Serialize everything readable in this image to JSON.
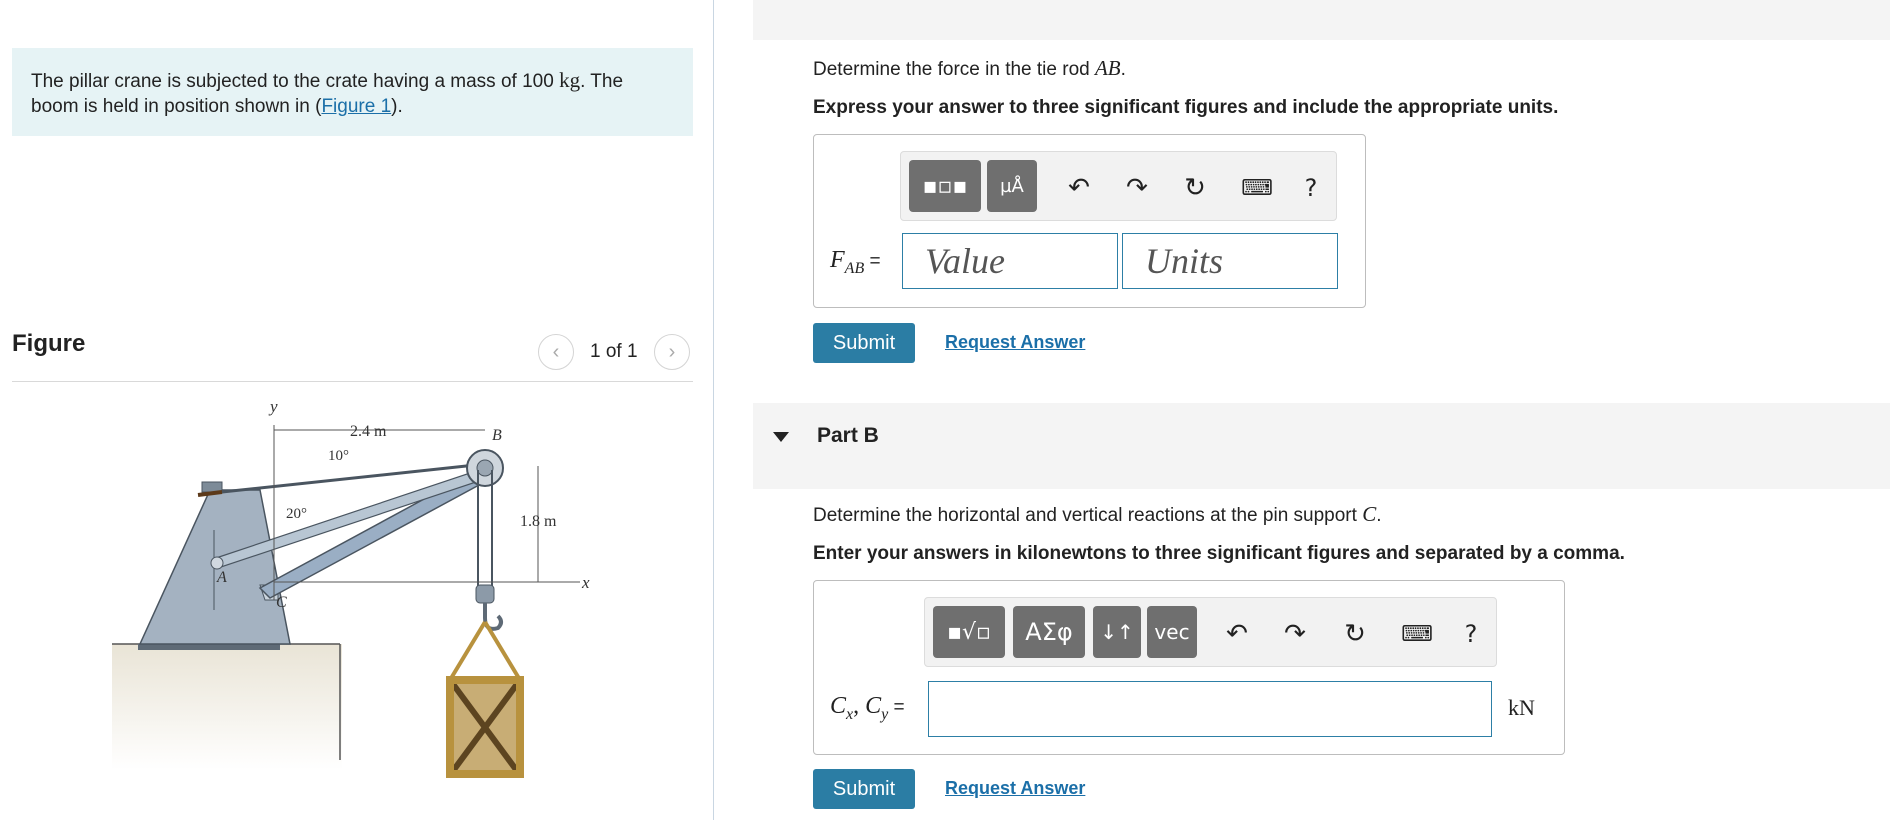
{
  "problem": {
    "text_before": "The pillar crane is subjected to the crate having a mass of 100 ",
    "mass_unit": "kg",
    "text_middle": ". The boom is held in position shown in (",
    "figure_link": "Figure 1",
    "text_after": ")."
  },
  "figure": {
    "title": "Figure",
    "counter": "1 of 1",
    "prev_icon": "chevron-left-icon",
    "next_icon": "chevron-right-icon",
    "labels": {
      "y": "y",
      "x": "x",
      "A": "A",
      "B": "B",
      "C": "C",
      "dim_horizontal": "2.4 m",
      "dim_vertical": "1.8 m",
      "angle_tie": "10°",
      "angle_boom": "20°"
    }
  },
  "partA": {
    "question_prefix": "Determine the force in the tie rod ",
    "question_var": "AB",
    "question_suffix": ".",
    "instruction": "Express your answer to three significant figures and include the appropriate units.",
    "var_label": "F",
    "var_sub": "AB",
    "equals": " =",
    "value_placeholder": "Value",
    "units_placeholder": "Units",
    "submit_label": "Submit",
    "request_label": "Request Answer",
    "toolbar_unit_glyph": "µÅ"
  },
  "partB": {
    "title": "Part B",
    "question_prefix": "Determine the horizontal and vertical reactions at the pin support ",
    "question_var": "C",
    "question_suffix": ".",
    "instruction": "Enter your answers in kilonewtons to three significant figures and separated by a comma.",
    "var_label": "C",
    "var_sub_x": "x",
    "var_sep": ", ",
    "var_label_2": "C",
    "var_sub_y": "y",
    "equals": " =",
    "unit": "kN",
    "submit_label": "Submit",
    "request_label": "Request Answer",
    "toolbar_greek": "ΑΣφ",
    "toolbar_vec": "vec",
    "toolbar_help": "?"
  },
  "toolbar_help": "?",
  "colors": {
    "accent": "#2b7da4",
    "link": "#1b6fa8",
    "problem_bg": "#e6f3f5",
    "tool_button": "#6f6f6f",
    "band": "#f4f4f4"
  }
}
